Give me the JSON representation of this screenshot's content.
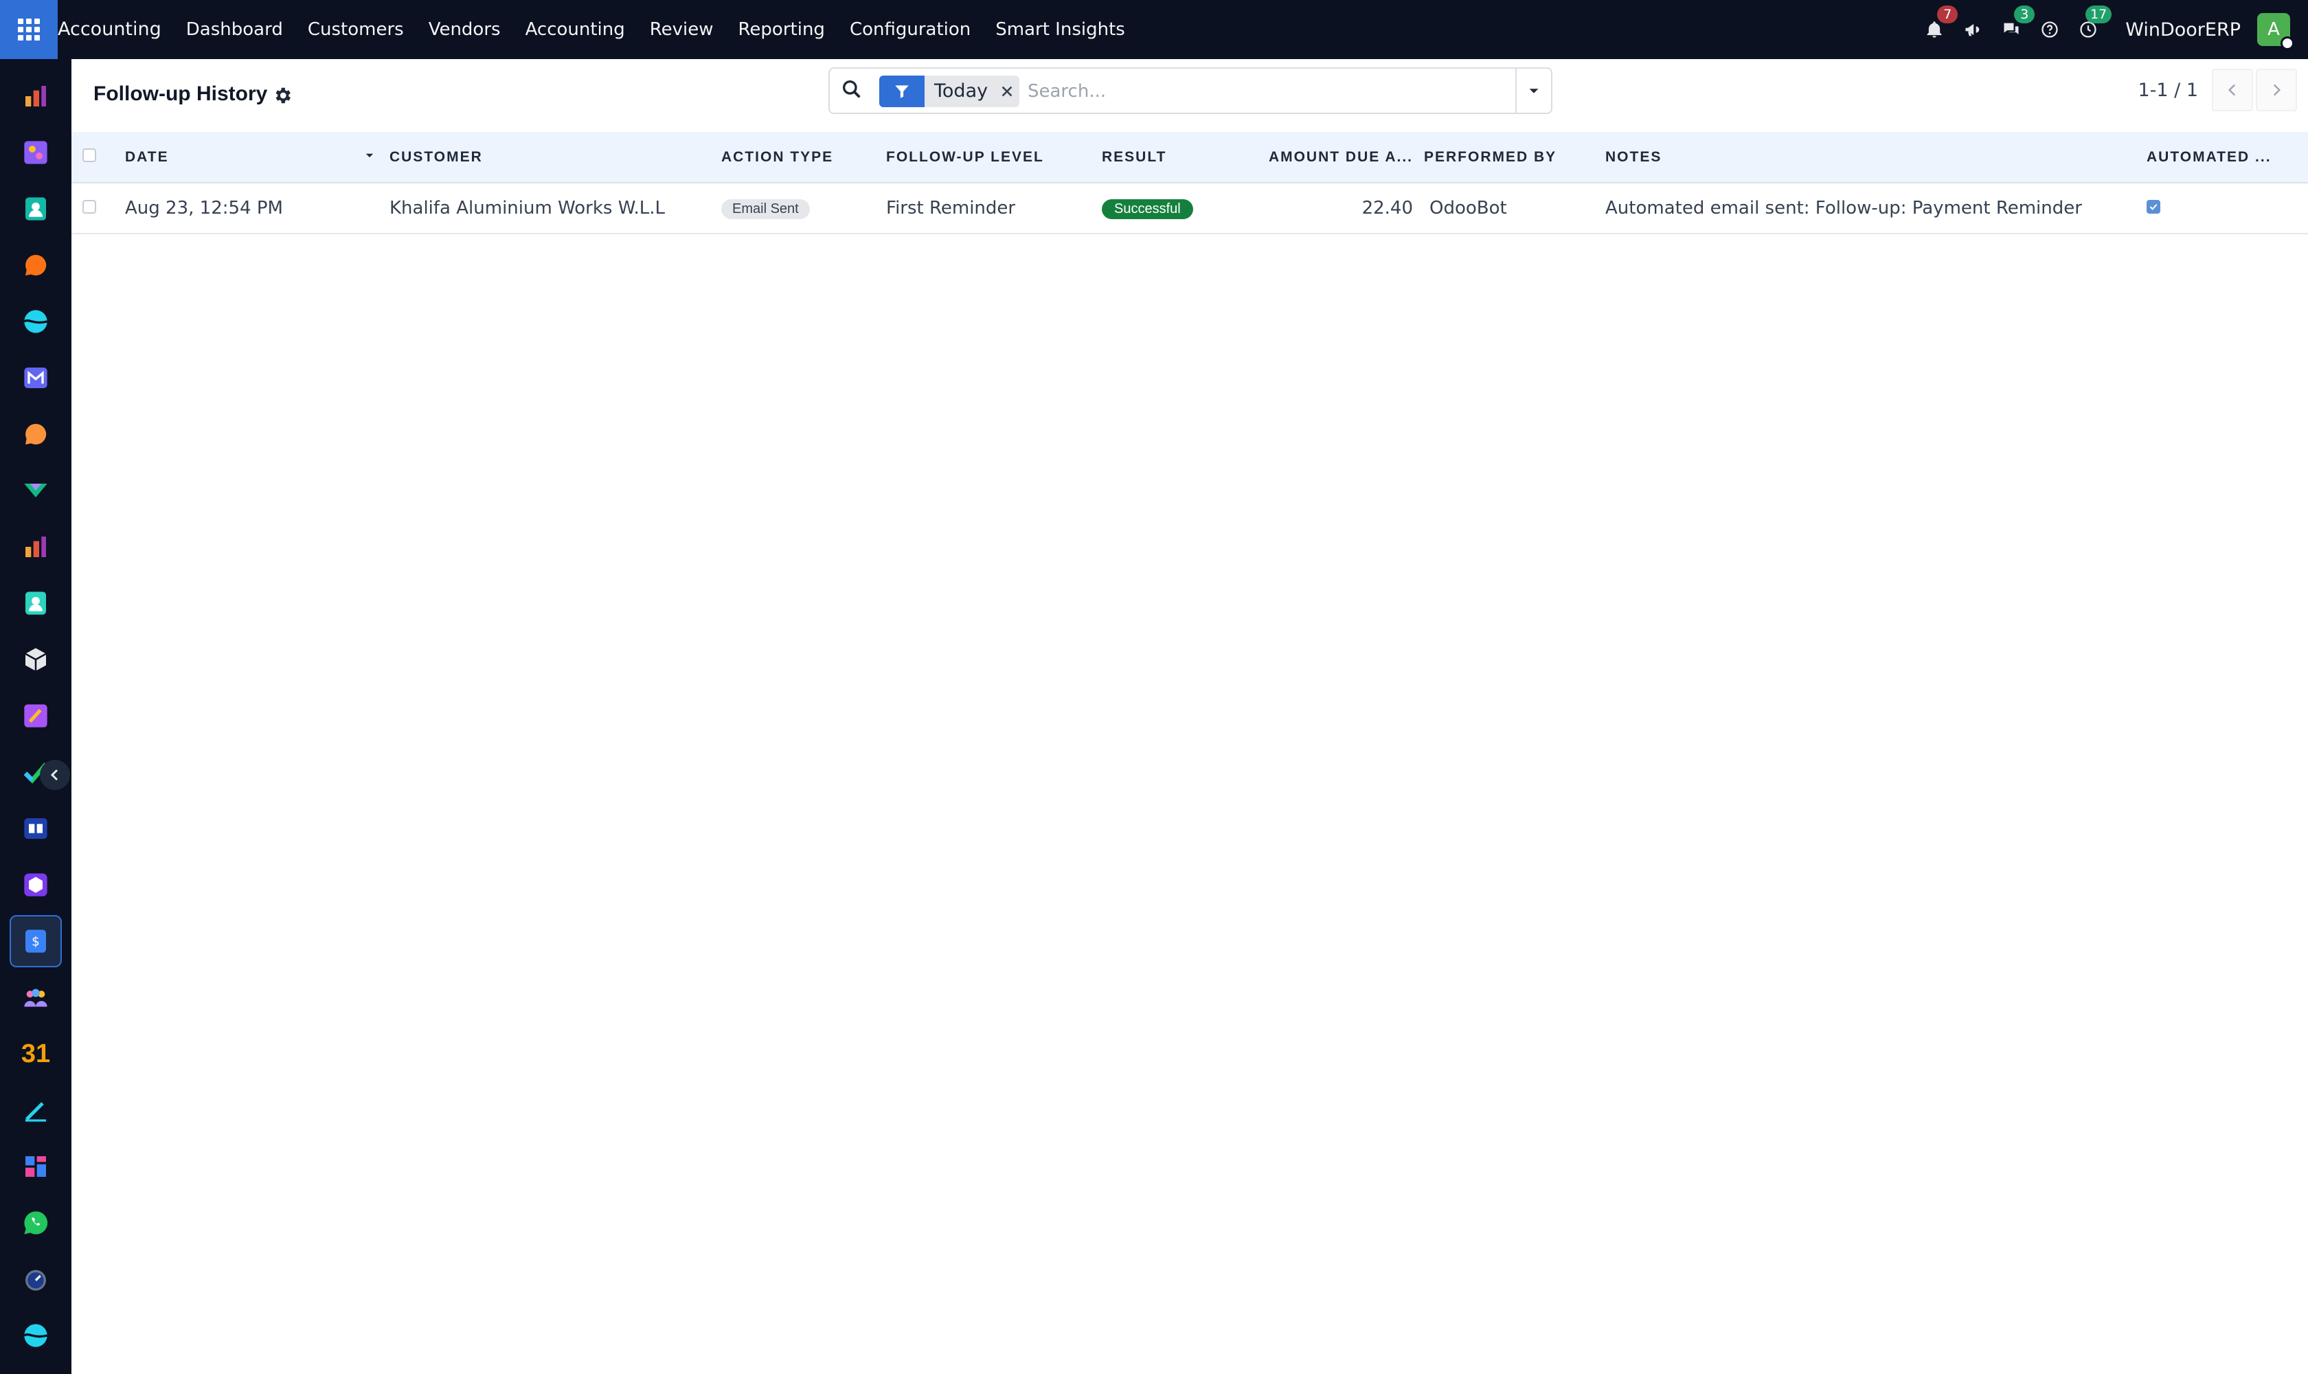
{
  "navbar": {
    "app_name": "Accounting",
    "menu": [
      "Dashboard",
      "Customers",
      "Vendors",
      "Accounting",
      "Review",
      "Reporting",
      "Configuration",
      "Smart Insights"
    ],
    "notifications_count": "7",
    "messages_count": "3",
    "activities_count": "17",
    "company": "WinDoorERP",
    "avatar_initial": "A"
  },
  "control_panel": {
    "title": "Follow-up History",
    "facet_label": "Today",
    "search_placeholder": "Search...",
    "pager_value": "1-1 / 1"
  },
  "table": {
    "columns": [
      "DATE",
      "CUSTOMER",
      "ACTION TYPE",
      "FOLLOW-UP LEVEL",
      "RESULT",
      "AMOUNT DUE A...",
      "PERFORMED BY",
      "NOTES",
      "AUTOMATED ..."
    ],
    "rows": [
      {
        "date": "Aug 23, 12:54 PM",
        "customer": "Khalifa Aluminium Works W.L.L",
        "action_type": "Email Sent",
        "followup_level": "First Reminder",
        "result": "Successful",
        "amount_due": "22.40",
        "performed_by": "OdooBot",
        "notes": "Automated email sent: Follow-up: Payment Reminder",
        "automated": true
      }
    ]
  },
  "sidebar": {
    "calendar_label": "31",
    "active_index": 15
  },
  "colors": {
    "navbar_bg": "#0b1120",
    "primary": "#2f6fd6",
    "success": "#15803d",
    "header_bg": "#edf4fd"
  }
}
